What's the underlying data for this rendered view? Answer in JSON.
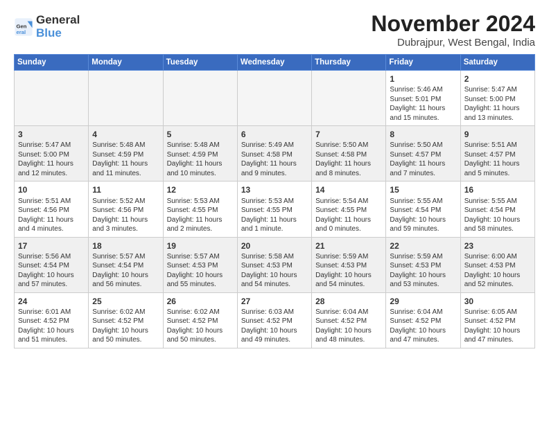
{
  "header": {
    "logo_line1": "General",
    "logo_line2": "Blue",
    "month": "November 2024",
    "location": "Dubrajpur, West Bengal, India"
  },
  "weekdays": [
    "Sunday",
    "Monday",
    "Tuesday",
    "Wednesday",
    "Thursday",
    "Friday",
    "Saturday"
  ],
  "weeks": [
    [
      {
        "day": "",
        "text": ""
      },
      {
        "day": "",
        "text": ""
      },
      {
        "day": "",
        "text": ""
      },
      {
        "day": "",
        "text": ""
      },
      {
        "day": "",
        "text": ""
      },
      {
        "day": "1",
        "text": "Sunrise: 5:46 AM\nSunset: 5:01 PM\nDaylight: 11 hours\nand 15 minutes."
      },
      {
        "day": "2",
        "text": "Sunrise: 5:47 AM\nSunset: 5:00 PM\nDaylight: 11 hours\nand 13 minutes."
      }
    ],
    [
      {
        "day": "3",
        "text": "Sunrise: 5:47 AM\nSunset: 5:00 PM\nDaylight: 11 hours\nand 12 minutes."
      },
      {
        "day": "4",
        "text": "Sunrise: 5:48 AM\nSunset: 4:59 PM\nDaylight: 11 hours\nand 11 minutes."
      },
      {
        "day": "5",
        "text": "Sunrise: 5:48 AM\nSunset: 4:59 PM\nDaylight: 11 hours\nand 10 minutes."
      },
      {
        "day": "6",
        "text": "Sunrise: 5:49 AM\nSunset: 4:58 PM\nDaylight: 11 hours\nand 9 minutes."
      },
      {
        "day": "7",
        "text": "Sunrise: 5:50 AM\nSunset: 4:58 PM\nDaylight: 11 hours\nand 8 minutes."
      },
      {
        "day": "8",
        "text": "Sunrise: 5:50 AM\nSunset: 4:57 PM\nDaylight: 11 hours\nand 7 minutes."
      },
      {
        "day": "9",
        "text": "Sunrise: 5:51 AM\nSunset: 4:57 PM\nDaylight: 11 hours\nand 5 minutes."
      }
    ],
    [
      {
        "day": "10",
        "text": "Sunrise: 5:51 AM\nSunset: 4:56 PM\nDaylight: 11 hours\nand 4 minutes."
      },
      {
        "day": "11",
        "text": "Sunrise: 5:52 AM\nSunset: 4:56 PM\nDaylight: 11 hours\nand 3 minutes."
      },
      {
        "day": "12",
        "text": "Sunrise: 5:53 AM\nSunset: 4:55 PM\nDaylight: 11 hours\nand 2 minutes."
      },
      {
        "day": "13",
        "text": "Sunrise: 5:53 AM\nSunset: 4:55 PM\nDaylight: 11 hours\nand 1 minute."
      },
      {
        "day": "14",
        "text": "Sunrise: 5:54 AM\nSunset: 4:55 PM\nDaylight: 11 hours\nand 0 minutes."
      },
      {
        "day": "15",
        "text": "Sunrise: 5:55 AM\nSunset: 4:54 PM\nDaylight: 10 hours\nand 59 minutes."
      },
      {
        "day": "16",
        "text": "Sunrise: 5:55 AM\nSunset: 4:54 PM\nDaylight: 10 hours\nand 58 minutes."
      }
    ],
    [
      {
        "day": "17",
        "text": "Sunrise: 5:56 AM\nSunset: 4:54 PM\nDaylight: 10 hours\nand 57 minutes."
      },
      {
        "day": "18",
        "text": "Sunrise: 5:57 AM\nSunset: 4:54 PM\nDaylight: 10 hours\nand 56 minutes."
      },
      {
        "day": "19",
        "text": "Sunrise: 5:57 AM\nSunset: 4:53 PM\nDaylight: 10 hours\nand 55 minutes."
      },
      {
        "day": "20",
        "text": "Sunrise: 5:58 AM\nSunset: 4:53 PM\nDaylight: 10 hours\nand 54 minutes."
      },
      {
        "day": "21",
        "text": "Sunrise: 5:59 AM\nSunset: 4:53 PM\nDaylight: 10 hours\nand 54 minutes."
      },
      {
        "day": "22",
        "text": "Sunrise: 5:59 AM\nSunset: 4:53 PM\nDaylight: 10 hours\nand 53 minutes."
      },
      {
        "day": "23",
        "text": "Sunrise: 6:00 AM\nSunset: 4:53 PM\nDaylight: 10 hours\nand 52 minutes."
      }
    ],
    [
      {
        "day": "24",
        "text": "Sunrise: 6:01 AM\nSunset: 4:52 PM\nDaylight: 10 hours\nand 51 minutes."
      },
      {
        "day": "25",
        "text": "Sunrise: 6:02 AM\nSunset: 4:52 PM\nDaylight: 10 hours\nand 50 minutes."
      },
      {
        "day": "26",
        "text": "Sunrise: 6:02 AM\nSunset: 4:52 PM\nDaylight: 10 hours\nand 50 minutes."
      },
      {
        "day": "27",
        "text": "Sunrise: 6:03 AM\nSunset: 4:52 PM\nDaylight: 10 hours\nand 49 minutes."
      },
      {
        "day": "28",
        "text": "Sunrise: 6:04 AM\nSunset: 4:52 PM\nDaylight: 10 hours\nand 48 minutes."
      },
      {
        "day": "29",
        "text": "Sunrise: 6:04 AM\nSunset: 4:52 PM\nDaylight: 10 hours\nand 47 minutes."
      },
      {
        "day": "30",
        "text": "Sunrise: 6:05 AM\nSunset: 4:52 PM\nDaylight: 10 hours\nand 47 minutes."
      }
    ]
  ]
}
